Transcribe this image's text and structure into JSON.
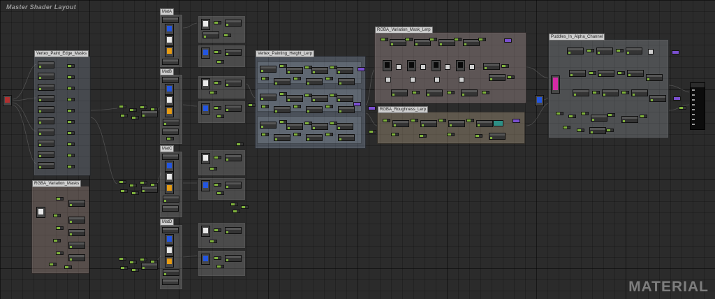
{
  "header": {
    "title": "Master Shader Layout"
  },
  "watermark": "MATERIAL",
  "comments": {
    "vertex_paint_edge_masks": "Vertex_Paint_Edge_Masks",
    "rgba_variation_masks": "RGBA_Variation_Masks",
    "mat_a": "MatA",
    "mat_b": "MatB",
    "mat_c": "MatC",
    "mat_d": "MatD",
    "vertex_painting_height_lerp": "Vertex_Painting_Height_Lerp",
    "rgba_variation_mask_lerp": "RGBA_Variation_Mask_Lerp",
    "rgba_roughness_lerp": "RGBA_Roughness_Lerp",
    "puddles_in_alpha_channel": "Puddles_In_Alpha_Channel"
  },
  "colors": {
    "canvas_bg": "#2b2b2b",
    "node_green": "#7fb23c",
    "node_blue": "#2456e0",
    "node_orange": "#e69c14",
    "node_magenta": "#d42ba6",
    "node_purple": "#7a4fd0",
    "node_teal": "#2e8f85"
  }
}
